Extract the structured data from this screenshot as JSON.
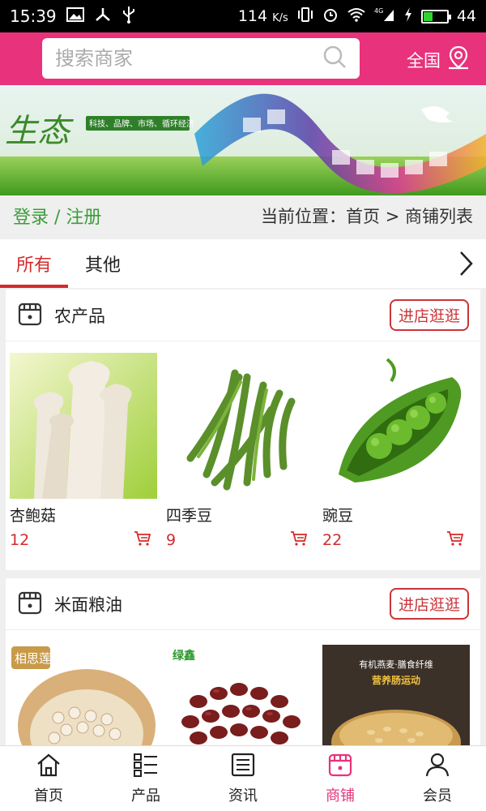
{
  "status": {
    "time": "15:39",
    "speed": "114",
    "speed_unit": "K/s",
    "net": "4G",
    "battery": "44",
    "battery_level": 0.44
  },
  "header": {
    "search_placeholder": "搜索商家",
    "region": "全国"
  },
  "banner": {
    "logo_text": "生态",
    "slogan": "科技、品牌、市场、循环经济"
  },
  "crumb": {
    "login": "登录 / 注册",
    "location": "当前位置：首页 > 商铺列表"
  },
  "tabs": [
    {
      "label": "所有"
    },
    {
      "label": "其他"
    }
  ],
  "shops": [
    {
      "name": "农产品",
      "visit": "进店逛逛",
      "products": [
        {
          "name": "杏鲍菇",
          "price": "12"
        },
        {
          "name": "四季豆",
          "price": "9"
        },
        {
          "name": "豌豆",
          "price": "22"
        }
      ]
    },
    {
      "name": "米面粮油",
      "visit": "进店逛逛",
      "products": [
        {
          "name": "",
          "price": "",
          "brand": "相思莲"
        },
        {
          "name": "",
          "price": "",
          "brand": "绿鑫"
        },
        {
          "name": "",
          "price": "",
          "caption1": "有机燕麦·膳食纤维",
          "caption2": "营养肠运动"
        }
      ]
    }
  ],
  "nav": [
    {
      "label": "首页"
    },
    {
      "label": "产品"
    },
    {
      "label": "资讯"
    },
    {
      "label": "商铺"
    },
    {
      "label": "会员"
    }
  ],
  "colors": {
    "brand": "#e8327b",
    "accent": "#d42a2a",
    "green": "#3c9c3c"
  }
}
